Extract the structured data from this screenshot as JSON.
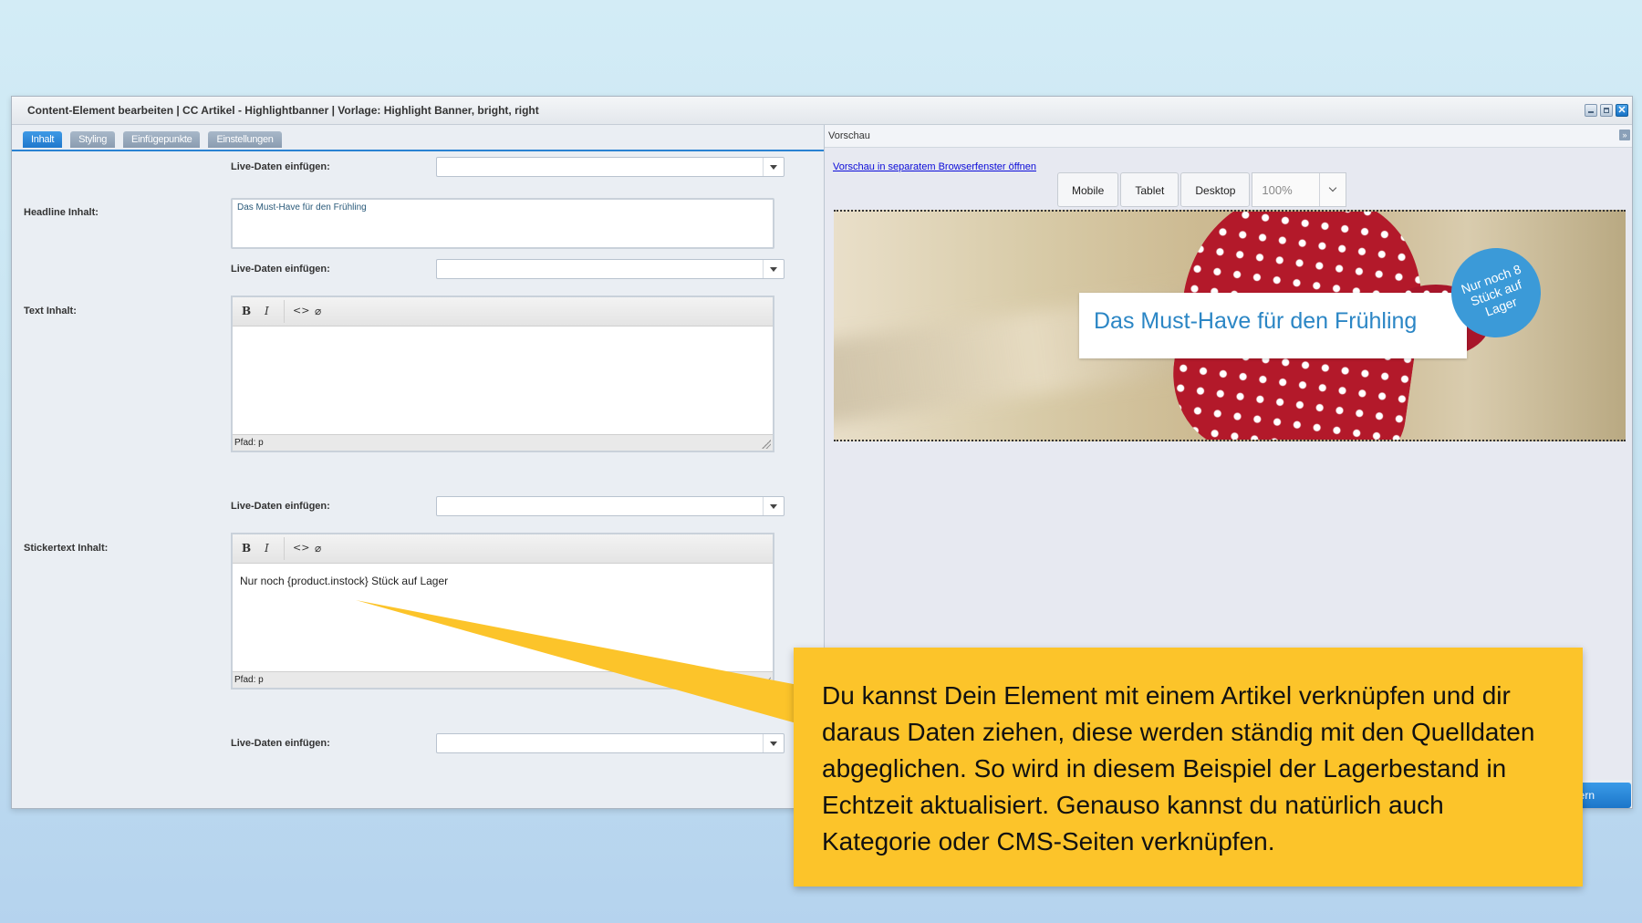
{
  "window": {
    "title": "Content-Element bearbeiten | CC Artikel - Highlightbanner | Vorlage: Highlight Banner, bright, right"
  },
  "tabs": [
    {
      "label": "Inhalt"
    },
    {
      "label": "Styling"
    },
    {
      "label": "Einfügepunkte"
    },
    {
      "label": "Einstellungen"
    }
  ],
  "form": {
    "live_label": "Live-Daten einfügen:",
    "headline_label": "Headline Inhalt:",
    "headline_value": "Das Must-Have für den Frühling",
    "text_label": "Text Inhalt:",
    "sticker_label": "Stickertext Inhalt:",
    "sticker_value": "Nur noch {product.instock} Stück auf Lager",
    "path_label": "Pfad: p",
    "toolbar": {
      "bold": "B",
      "italic": "I"
    }
  },
  "preview": {
    "header": "Vorschau",
    "link": "Vorschau in separatem Browserfenster öffnen",
    "devices": [
      "Mobile",
      "Tablet",
      "Desktop"
    ],
    "zoom": "100%",
    "banner_headline": "Das Must-Have für den Frühling",
    "sticker_text": "Nur noch 8 Stück auf Lager"
  },
  "save_button": "hern",
  "callout": {
    "text": "Du kannst Dein Element mit einem Artikel verknüpfen und dir daraus Daten ziehen, diese werden ständig mit den Quelldaten abgeglichen. So wird in diesem Beispiel der Lagerbestand in Echtzeit aktualisiert. Genauso kannst du natürlich auch Kategorie oder CMS-Seiten verknüpfen.",
    "color": "#fcc42a"
  }
}
